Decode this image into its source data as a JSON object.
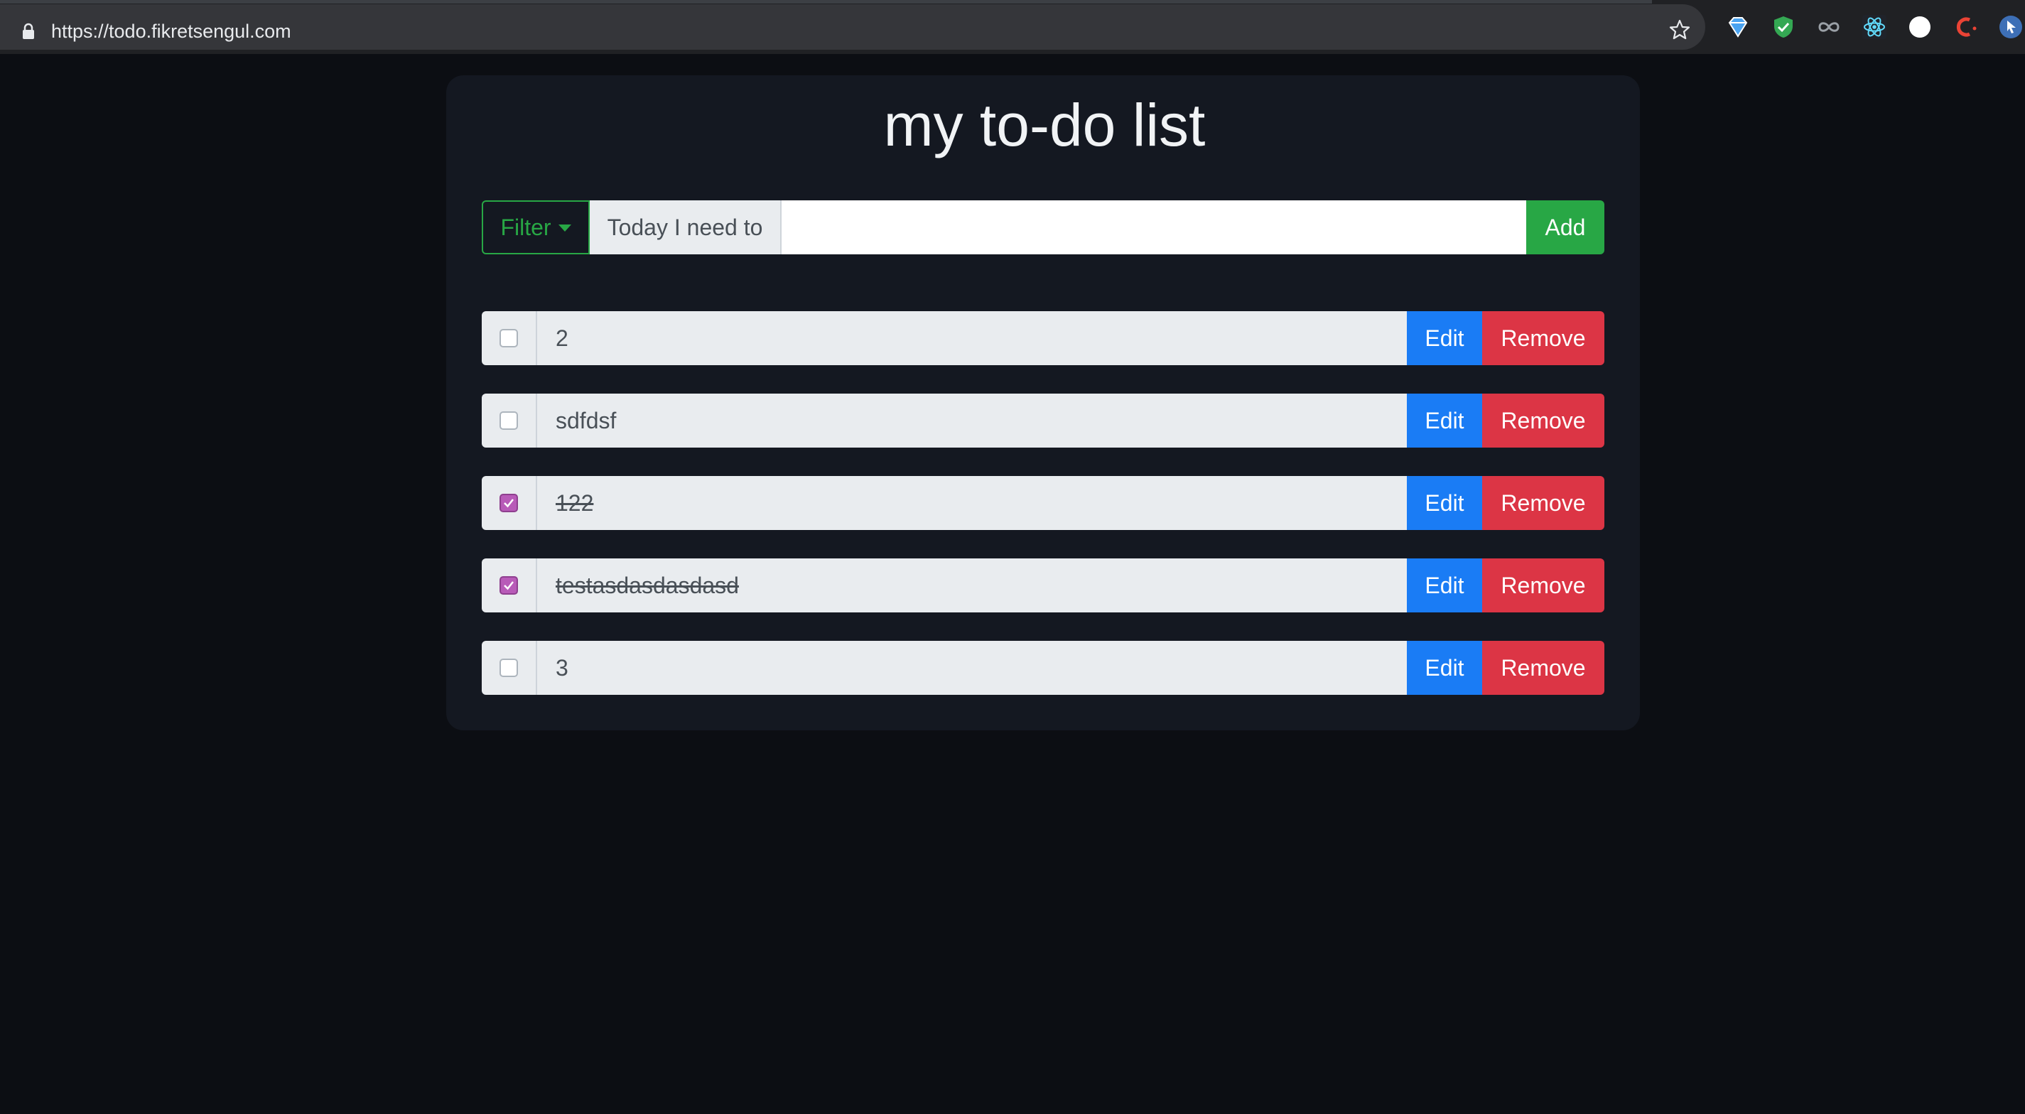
{
  "browser": {
    "url": "https://todo.fikretsengul.com",
    "extensions": [
      "diamond-icon",
      "shield-check-icon",
      "infinity-icon",
      "react-atom-icon",
      "compass-icon",
      "c-logo-icon",
      "cursor-icon"
    ]
  },
  "app": {
    "title": "my to-do list"
  },
  "input_row": {
    "filter_label": "Filter",
    "prefix_label": "Today I need to",
    "input_value": "",
    "input_placeholder": "",
    "add_label": "Add"
  },
  "todos": [
    {
      "text": "2",
      "completed": false,
      "edit_label": "Edit",
      "remove_label": "Remove"
    },
    {
      "text": "sdfdsf",
      "completed": false,
      "edit_label": "Edit",
      "remove_label": "Remove"
    },
    {
      "text": "122",
      "completed": true,
      "edit_label": "Edit",
      "remove_label": "Remove"
    },
    {
      "text": "testasdasdasdasd",
      "completed": true,
      "edit_label": "Edit",
      "remove_label": "Remove"
    },
    {
      "text": "3",
      "completed": false,
      "edit_label": "Edit",
      "remove_label": "Remove"
    }
  ],
  "colors": {
    "page_bg": "#0c0e13",
    "card_bg": "#141821",
    "success": "#28a745",
    "primary": "#1a7cf5",
    "danger": "#dc3545",
    "checked": "#b85bb8"
  }
}
